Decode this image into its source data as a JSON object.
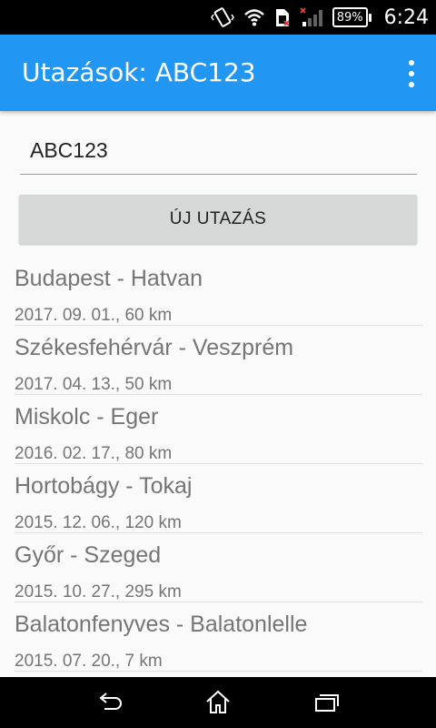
{
  "status_bar": {
    "battery": "89%",
    "time": "6:24",
    "icons": [
      "vibrate-icon",
      "wifi-icon",
      "sim-icon",
      "signal-icon",
      "battery-icon"
    ]
  },
  "app_bar": {
    "title": "Utazások: ABC123",
    "overflow_icon": "more-vert-icon"
  },
  "form": {
    "plate_value": "ABC123",
    "new_trip_label": "ÚJ UTAZÁS"
  },
  "trips": [
    {
      "route": "Budapest - Hatvan",
      "meta": "2017. 09. 01., 60 km"
    },
    {
      "route": "Székesfehérvár - Veszprém",
      "meta": "2017. 04. 13., 50 km"
    },
    {
      "route": "Miskolc - Eger",
      "meta": "2016. 02. 17., 80 km"
    },
    {
      "route": "Hortobágy - Tokaj",
      "meta": "2015. 12. 06., 120 km"
    },
    {
      "route": "Győr - Szeged",
      "meta": "2015. 10. 27., 295 km"
    },
    {
      "route": "Balatonfenyves - Balatonlelle",
      "meta": "2015. 07. 20., 7 km"
    }
  ],
  "nav_bar": {
    "icons": [
      "back-icon",
      "home-icon",
      "recents-icon"
    ]
  },
  "colors": {
    "primary": "#2196f3",
    "button": "#d6d7d7"
  }
}
